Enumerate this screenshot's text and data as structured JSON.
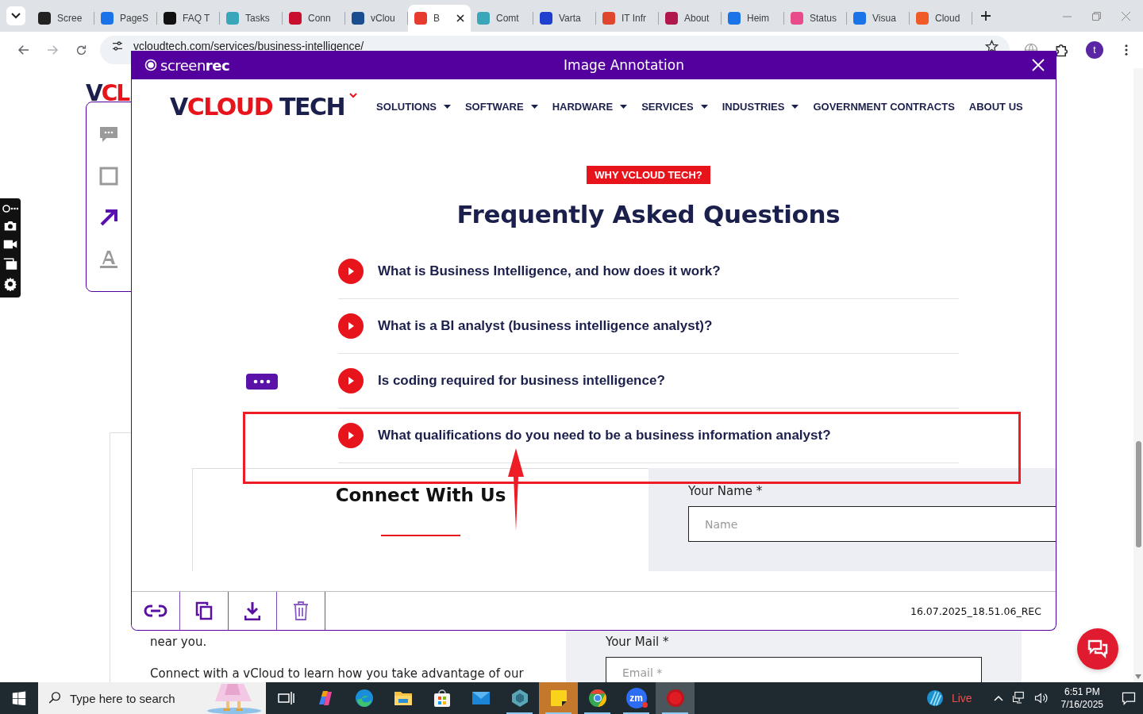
{
  "browser": {
    "tabs": [
      {
        "title": "Scree",
        "color": "#222222",
        "selected": false
      },
      {
        "title": "PageS",
        "color": "#1a73e8",
        "selected": false
      },
      {
        "title": "FAQ T",
        "color": "#111111",
        "selected": false
      },
      {
        "title": "Tasks",
        "color": "#3aa6b9",
        "selected": false
      },
      {
        "title": "Conn",
        "color": "#c8102e",
        "selected": false
      },
      {
        "title": "vClou",
        "color": "#1a4d8f",
        "selected": false
      },
      {
        "title": "B",
        "color": "#e63b2e",
        "selected": true
      },
      {
        "title": "Comt",
        "color": "#3aa6b9",
        "selected": false
      },
      {
        "title": "Varta",
        "color": "#1f3fcf",
        "selected": false
      },
      {
        "title": "IT Infr",
        "color": "#e0452e",
        "selected": false
      },
      {
        "title": "About",
        "color": "#b0174a",
        "selected": false
      },
      {
        "title": "Heim",
        "color": "#1a73e8",
        "selected": false
      },
      {
        "title": "Status",
        "color": "#e84a8a",
        "selected": false
      },
      {
        "title": "Visua",
        "color": "#1a73e8",
        "selected": false
      },
      {
        "title": "Cloud",
        "color": "#f05a28",
        "selected": false
      }
    ],
    "address": "vcloudtech.com/services/business-intelligence/",
    "profile_initial": "t"
  },
  "page": {
    "logo": {
      "lead": "V",
      "accent": "CL"
    },
    "body_lines": [
      "near you.",
      "Connect with a vCloud to learn how you take advantage of our"
    ],
    "mail_label": "Your Mail *",
    "mail_placeholder": "Email *"
  },
  "tool_panel": {
    "tools": [
      {
        "kind": "comment",
        "selected": false
      },
      {
        "kind": "rectangle",
        "selected": false
      },
      {
        "kind": "arrow",
        "selected": true
      },
      {
        "kind": "text",
        "selected": false
      }
    ]
  },
  "modal": {
    "brand": "screen**rec**",
    "title": "Image Annotation",
    "filename": "16.07.2025_18.51.06_REC",
    "actions": [
      {
        "kind": "link"
      },
      {
        "kind": "copy"
      },
      {
        "kind": "download"
      },
      {
        "kind": "delete"
      }
    ]
  },
  "site": {
    "logo": {
      "lead": "V",
      "accent": "CLOUD",
      "tail": "TECH"
    },
    "nav": [
      {
        "label": "SOLUTIONS",
        "has_menu": true
      },
      {
        "label": "SOFTWARE",
        "has_menu": true
      },
      {
        "label": "HARDWARE",
        "has_menu": true
      },
      {
        "label": "SERVICES",
        "has_menu": true
      },
      {
        "label": "INDUSTRIES",
        "has_menu": true
      },
      {
        "label": "GOVERNMENT CONTRACTS",
        "has_menu": false
      },
      {
        "label": "ABOUT US",
        "has_menu": false
      }
    ],
    "badge": "WHY VCLOUD TECH?",
    "heading": "Frequently Asked Questions",
    "faqs": [
      "What is Business Intelligence, and how does it work?",
      "What is a BI analyst (business intelligence analyst)?",
      "Is coding required for business intelligence?",
      "What qualifications do you need to be a business information analyst?"
    ],
    "connect_heading": "Connect With Us",
    "name_label": "Your Name *",
    "name_placeholder": "Name"
  },
  "taskbar": {
    "search_placeholder": "Type here to search",
    "apps": [
      {
        "kind": "task-view",
        "running": false,
        "selected": false,
        "flashing": false
      },
      {
        "kind": "copilot",
        "running": false,
        "selected": false,
        "flashing": false
      },
      {
        "kind": "edge",
        "running": false,
        "selected": false,
        "flashing": false
      },
      {
        "kind": "explorer",
        "running": false,
        "selected": false,
        "flashing": false
      },
      {
        "kind": "store",
        "running": false,
        "selected": false,
        "flashing": false
      },
      {
        "kind": "mail",
        "running": false,
        "selected": false,
        "flashing": false
      },
      {
        "kind": "hex-app",
        "running": true,
        "selected": false,
        "flashing": false
      },
      {
        "kind": "sticky-notes",
        "running": true,
        "selected": false,
        "flashing": true
      },
      {
        "kind": "chrome",
        "running": true,
        "selected": false,
        "flashing": false
      },
      {
        "kind": "zoom",
        "label": "zm",
        "running": true,
        "selected": false,
        "flashing": false
      },
      {
        "kind": "screenrec",
        "running": true,
        "selected": true,
        "flashing": false
      }
    ],
    "weather": "Live",
    "time": "6:51 PM",
    "date": "7/16/2025"
  }
}
